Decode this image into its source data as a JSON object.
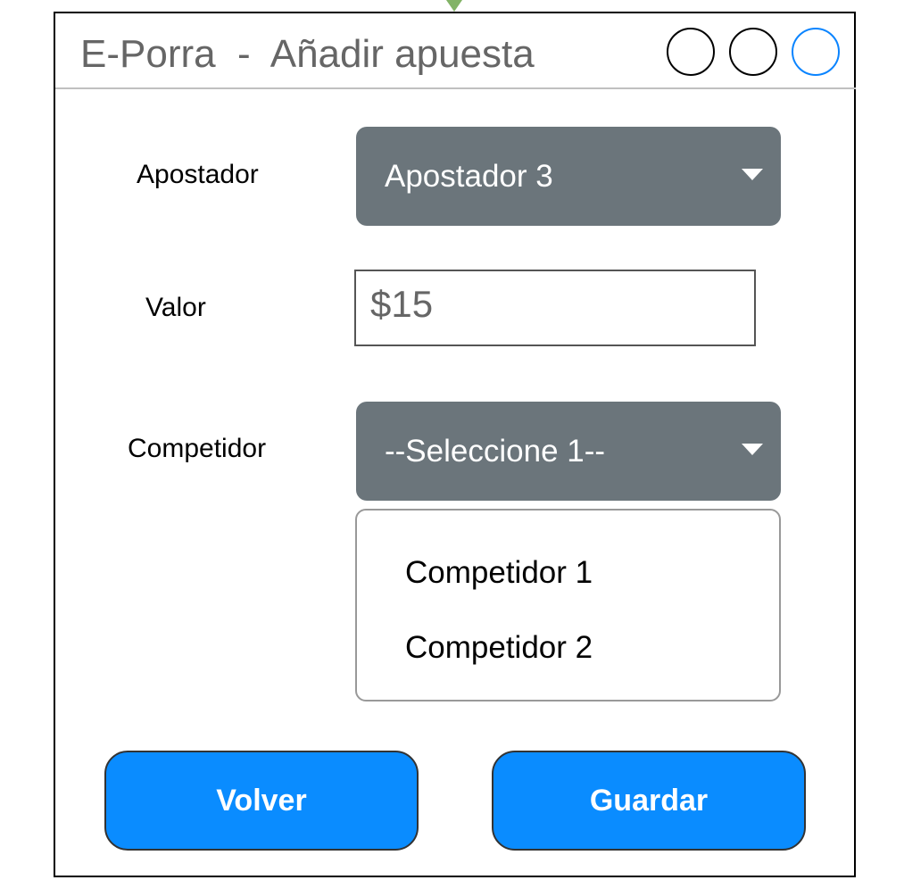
{
  "window": {
    "title": "E-Porra  -  Añadir apuesta"
  },
  "form": {
    "apostador": {
      "label": "Apostador",
      "selected": "Apostador 3"
    },
    "valor": {
      "label": "Valor",
      "value": "$15"
    },
    "competidor": {
      "label": "Competidor",
      "selected": "--Seleccione 1--",
      "options": [
        "Competidor 1",
        "Competidor 2"
      ]
    }
  },
  "buttons": {
    "back_label": "Volver",
    "save_label": "Guardar"
  },
  "colors": {
    "select_bg": "#6b757b",
    "button_bg": "#0a8cff",
    "accent_circle": "#0a84ff"
  }
}
